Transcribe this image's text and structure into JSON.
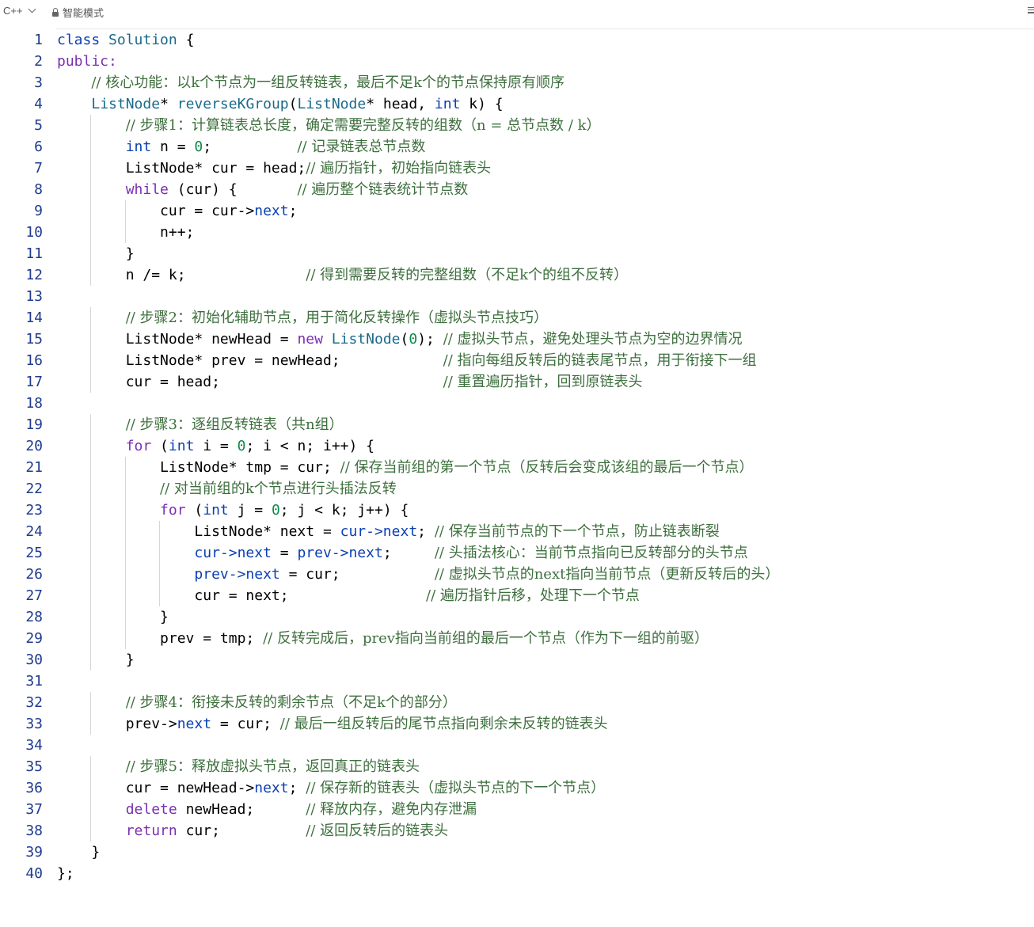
{
  "toolbar": {
    "language": "C++",
    "mode": "智能模式"
  },
  "code_lines": [
    [
      [
        "class",
        "kb"
      ],
      [
        " "
      ],
      [
        "Solution",
        "ty"
      ],
      [
        " {"
      ]
    ],
    [
      [
        "public:",
        "kw"
      ]
    ],
    [
      [
        "    "
      ],
      [
        "// 核心功能：以k个节点为一组反转链表，最后不足k个的节点保持原有顺序",
        "cm"
      ]
    ],
    [
      [
        "    "
      ],
      [
        "ListNode",
        "ty"
      ],
      [
        "* "
      ],
      [
        "reverseKGroup",
        "ty"
      ],
      [
        "("
      ],
      [
        "ListNode",
        "ty"
      ],
      [
        "* head, "
      ],
      [
        "int",
        "kb"
      ],
      [
        " k) {"
      ]
    ],
    [
      [
        "        "
      ],
      [
        "// 步骤1：计算链表总长度，确定需要完整反转的组数（n = 总节点数 / k）",
        "cm"
      ]
    ],
    [
      [
        "        "
      ],
      [
        "int",
        "kb"
      ],
      [
        " n = "
      ],
      [
        "0",
        "nu"
      ],
      [
        ";          "
      ],
      [
        "// 记录链表总节点数",
        "cm"
      ]
    ],
    [
      [
        "        ListNode* cur = head;"
      ],
      [
        "// 遍历指针，初始指向链表头",
        "cm"
      ]
    ],
    [
      [
        "        "
      ],
      [
        "while",
        "kw"
      ],
      [
        " (cur) {       "
      ],
      [
        "// 遍历整个链表统计节点数",
        "cm"
      ]
    ],
    [
      [
        "            cur = cur->"
      ],
      [
        "next",
        "kb"
      ],
      [
        ";"
      ]
    ],
    [
      [
        "            n++;"
      ]
    ],
    [
      [
        "        }"
      ]
    ],
    [
      [
        "        n /= k;              "
      ],
      [
        "// 得到需要反转的完整组数（不足k个的组不反转）",
        "cm"
      ]
    ],
    [
      [
        ""
      ]
    ],
    [
      [
        "        "
      ],
      [
        "// 步骤2：初始化辅助节点，用于简化反转操作（虚拟头节点技巧）",
        "cm"
      ]
    ],
    [
      [
        "        ListNode* newHead = "
      ],
      [
        "new",
        "kw"
      ],
      [
        " "
      ],
      [
        "ListNode",
        "ty"
      ],
      [
        "("
      ],
      [
        "0",
        "nu"
      ],
      [
        "); "
      ],
      [
        "// 虚拟头节点，避免处理头节点为空的边界情况",
        "cm"
      ]
    ],
    [
      [
        "        ListNode* prev = newHead;            "
      ],
      [
        "// 指向每组反转后的链表尾节点，用于衔接下一组",
        "cm"
      ]
    ],
    [
      [
        "        cur = head;                          "
      ],
      [
        "// 重置遍历指针，回到原链表头",
        "cm"
      ]
    ],
    [
      [
        ""
      ]
    ],
    [
      [
        "        "
      ],
      [
        "// 步骤3：逐组反转链表（共n组）",
        "cm"
      ]
    ],
    [
      [
        "        "
      ],
      [
        "for",
        "kw"
      ],
      [
        " ("
      ],
      [
        "int",
        "kb"
      ],
      [
        " i = "
      ],
      [
        "0",
        "nu"
      ],
      [
        "; i < n; i++) {"
      ]
    ],
    [
      [
        "            ListNode* tmp = cur; "
      ],
      [
        "// 保存当前组的第一个节点（反转后会变成该组的最后一个节点）",
        "cm"
      ]
    ],
    [
      [
        "            "
      ],
      [
        "// 对当前组的k个节点进行头插法反转",
        "cm"
      ]
    ],
    [
      [
        "            "
      ],
      [
        "for",
        "kw"
      ],
      [
        " ("
      ],
      [
        "int",
        "kb"
      ],
      [
        " j = "
      ],
      [
        "0",
        "nu"
      ],
      [
        "; j < k; j++) {"
      ]
    ],
    [
      [
        "                ListNode* next = "
      ],
      [
        "cur->next",
        "kb"
      ],
      [
        "; "
      ],
      [
        "// 保存当前节点的下一个节点，防止链表断裂",
        "cm"
      ]
    ],
    [
      [
        "                "
      ],
      [
        "cur->next",
        "kb"
      ],
      [
        " = "
      ],
      [
        "prev->next",
        "kb"
      ],
      [
        ";     "
      ],
      [
        "// 头插法核心：当前节点指向已反转部分的头节点",
        "cm"
      ]
    ],
    [
      [
        "                "
      ],
      [
        "prev->next",
        "kb"
      ],
      [
        " = cur;           "
      ],
      [
        "// 虚拟头节点的next指向当前节点（更新反转后的头）",
        "cm"
      ]
    ],
    [
      [
        "                cur = next;                "
      ],
      [
        "// 遍历指针后移，处理下一个节点",
        "cm"
      ]
    ],
    [
      [
        "            }"
      ]
    ],
    [
      [
        "            prev = tmp; "
      ],
      [
        "// 反转完成后，prev指向当前组的最后一个节点（作为下一组的前驱）",
        "cm"
      ]
    ],
    [
      [
        "        }"
      ]
    ],
    [
      [
        ""
      ]
    ],
    [
      [
        "        "
      ],
      [
        "// 步骤4：衔接未反转的剩余节点（不足k个的部分）",
        "cm"
      ]
    ],
    [
      [
        "        prev->"
      ],
      [
        "next",
        "kb"
      ],
      [
        " = cur; "
      ],
      [
        "// 最后一组反转后的尾节点指向剩余未反转的链表头",
        "cm"
      ]
    ],
    [
      [
        ""
      ]
    ],
    [
      [
        "        "
      ],
      [
        "// 步骤5：释放虚拟头节点，返回真正的链表头",
        "cm"
      ]
    ],
    [
      [
        "        cur = newHead->"
      ],
      [
        "next",
        "kb"
      ],
      [
        "; "
      ],
      [
        "// 保存新的链表头（虚拟头节点的下一个节点）",
        "cm"
      ]
    ],
    [
      [
        "        "
      ],
      [
        "delete",
        "kw"
      ],
      [
        " newHead;      "
      ],
      [
        "// 释放内存，避免内存泄漏",
        "cm"
      ]
    ],
    [
      [
        "        "
      ],
      [
        "return",
        "kw"
      ],
      [
        " cur;          "
      ],
      [
        "// 返回反转后的链表头",
        "cm"
      ]
    ],
    [
      [
        "    }"
      ]
    ],
    [
      [
        "};"
      ]
    ]
  ]
}
